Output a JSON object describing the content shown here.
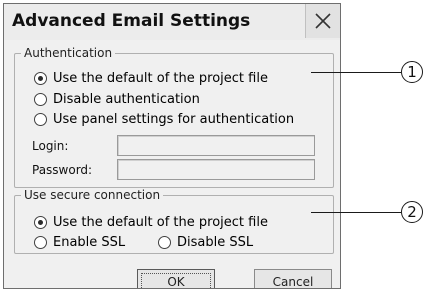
{
  "dialog": {
    "title": "Advanced Email Settings",
    "close_icon": "close-icon"
  },
  "authentication": {
    "legend": "Authentication",
    "options": [
      {
        "label": "Use the default of the project file",
        "selected": true
      },
      {
        "label": "Disable authentication",
        "selected": false
      },
      {
        "label": "Use panel settings for authentication",
        "selected": false
      }
    ],
    "login_label": "Login:",
    "login_value": "",
    "password_label": "Password:",
    "password_value": ""
  },
  "secure_connection": {
    "legend": "Use secure connection",
    "options": [
      {
        "label": "Use the default of the project file",
        "selected": true
      },
      {
        "label": "Enable SSL",
        "selected": false
      },
      {
        "label": "Disable SSL",
        "selected": false
      }
    ]
  },
  "buttons": {
    "ok_label": "OK",
    "cancel_label": "Cancel"
  },
  "callouts": [
    "1",
    "2"
  ]
}
